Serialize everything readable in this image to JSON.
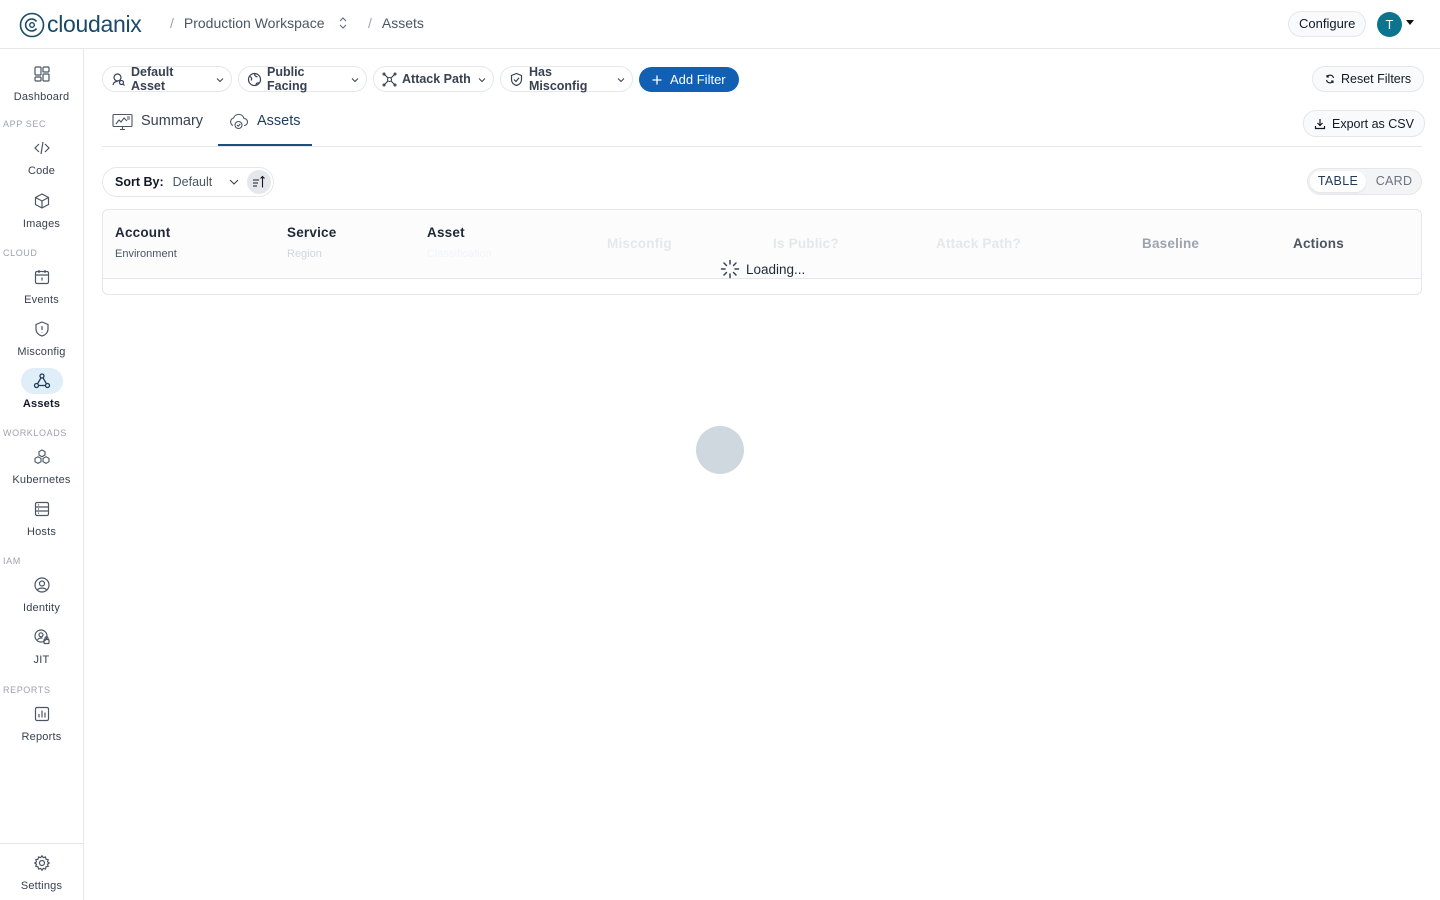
{
  "brand": {
    "name": "cloudanix"
  },
  "breadcrumb": {
    "workspace": "Production Workspace",
    "page": "Assets"
  },
  "header": {
    "configure_label": "Configure",
    "avatar_initial": "T"
  },
  "sidebar": {
    "dashboard": "Dashboard",
    "section_appsec": "APP SEC",
    "code": "Code",
    "images": "Images",
    "section_cloud": "CLOUD",
    "events": "Events",
    "misconfig": "Misconfig",
    "assets": "Assets",
    "section_workloads": "WORKLOADS",
    "kubernetes": "Kubernetes",
    "hosts": "Hosts",
    "section_iam": "IAM",
    "identity": "Identity",
    "jit": "JIT",
    "section_reports": "REPORTS",
    "reports": "Reports",
    "settings": "Settings"
  },
  "filters": {
    "default_asset": "Default Asset",
    "public_facing": "Public Facing",
    "attack_path": "Attack Path",
    "has_misconfig": "Has Misconfig",
    "add_filter": "Add Filter",
    "reset_filters": "Reset Filters"
  },
  "tabs": {
    "summary": "Summary",
    "assets": "Assets",
    "active": "Assets"
  },
  "toolbar": {
    "export_csv": "Export as CSV",
    "sort_by_label": "Sort By:",
    "sort_by_value": "Default",
    "view_table": "TABLE",
    "view_card": "CARD",
    "active_view": "TABLE"
  },
  "table": {
    "columns": {
      "account": "Account",
      "account_sub": "Environment",
      "service": "Service",
      "service_sub": "Region",
      "asset": "Asset",
      "asset_sub": "Classification",
      "misconfig": "Misconfig",
      "is_public": "Is Public?",
      "attack_path": "Attack Path?",
      "baseline": "Baseline",
      "actions": "Actions"
    },
    "loading_text": "Loading..."
  },
  "colors": {
    "primary": "#1260b3",
    "avatar_bg": "#0d7490",
    "active_nav_bg": "#e0eef8",
    "tab_underline": "#1e4f7a"
  }
}
